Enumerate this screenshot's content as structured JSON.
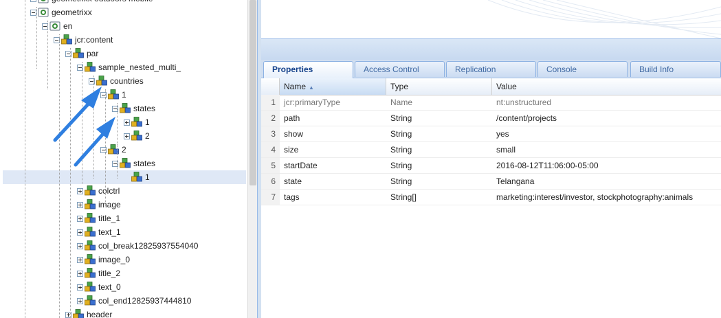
{
  "tree": {
    "nodes": [
      {
        "label": "geometrixx outdoors mobile",
        "depth": 0,
        "expander": "minus",
        "type": "page"
      },
      {
        "label": "geometrixx",
        "depth": 0,
        "expander": "minus",
        "type": "page"
      },
      {
        "label": "en",
        "depth": 1,
        "expander": "minus",
        "type": "page"
      },
      {
        "label": "jcr:content",
        "depth": 2,
        "expander": "minus",
        "type": "node"
      },
      {
        "label": "par",
        "depth": 3,
        "expander": "minus",
        "type": "node"
      },
      {
        "label": "sample_nested_multi_",
        "depth": 4,
        "expander": "minus",
        "type": "node"
      },
      {
        "label": "countries",
        "depth": 5,
        "expander": "minus",
        "type": "node"
      },
      {
        "label": "1",
        "depth": 6,
        "expander": "minus",
        "type": "node"
      },
      {
        "label": "states",
        "depth": 7,
        "expander": "minus",
        "type": "node"
      },
      {
        "label": "1",
        "depth": 8,
        "expander": "plus",
        "type": "node"
      },
      {
        "label": "2",
        "depth": 8,
        "expander": "plus",
        "type": "node"
      },
      {
        "label": "2",
        "depth": 6,
        "expander": "minus",
        "type": "node"
      },
      {
        "label": "states",
        "depth": 7,
        "expander": "minus",
        "type": "node"
      },
      {
        "label": "1",
        "depth": 8,
        "expander": "none",
        "type": "node",
        "selected": true
      },
      {
        "label": "colctrl",
        "depth": 4,
        "expander": "plus",
        "type": "node"
      },
      {
        "label": "image",
        "depth": 4,
        "expander": "plus",
        "type": "node"
      },
      {
        "label": "title_1",
        "depth": 4,
        "expander": "plus",
        "type": "node"
      },
      {
        "label": "text_1",
        "depth": 4,
        "expander": "plus",
        "type": "node"
      },
      {
        "label": "col_break12825937554040",
        "depth": 4,
        "expander": "plus",
        "type": "node"
      },
      {
        "label": "image_0",
        "depth": 4,
        "expander": "plus",
        "type": "node"
      },
      {
        "label": "title_2",
        "depth": 4,
        "expander": "plus",
        "type": "node"
      },
      {
        "label": "text_0",
        "depth": 4,
        "expander": "plus",
        "type": "node"
      },
      {
        "label": "col_end12825937444810",
        "depth": 4,
        "expander": "plus",
        "type": "node"
      },
      {
        "label": "header",
        "depth": 3,
        "expander": "plus",
        "type": "node"
      }
    ]
  },
  "tabs": [
    {
      "label": "Properties",
      "active": true
    },
    {
      "label": "Access Control",
      "active": false
    },
    {
      "label": "Replication",
      "active": false
    },
    {
      "label": "Console",
      "active": false
    },
    {
      "label": "Build Info",
      "active": false
    }
  ],
  "grid": {
    "columns": {
      "name": "Name",
      "type": "Type",
      "value": "Value"
    },
    "rows": [
      {
        "num": "1",
        "name": "jcr:primaryType",
        "type": "Name",
        "value": "nt:unstructured",
        "dim": true
      },
      {
        "num": "2",
        "name": "path",
        "type": "String",
        "value": "/content/projects"
      },
      {
        "num": "3",
        "name": "show",
        "type": "String",
        "value": "yes"
      },
      {
        "num": "4",
        "name": "size",
        "type": "String",
        "value": "small"
      },
      {
        "num": "5",
        "name": "startDate",
        "type": "String",
        "value": "2016-08-12T11:06:00-05:00"
      },
      {
        "num": "6",
        "name": "state",
        "type": "String",
        "value": "Telangana"
      },
      {
        "num": "7",
        "name": "tags",
        "type": "String[]",
        "value": "marketing:interest/investor, stockphotography:animals"
      }
    ]
  },
  "colors": {
    "accent": "#15428b",
    "arrow": "#2f7fe0",
    "selection": "#dfe8f6"
  }
}
